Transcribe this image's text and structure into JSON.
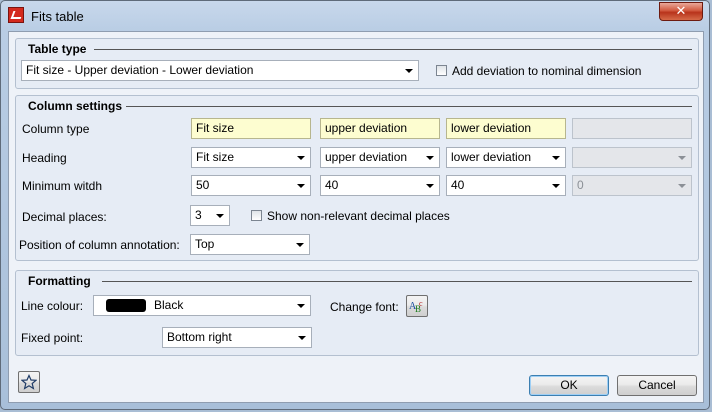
{
  "window": {
    "title": "Fits table",
    "close_label": "✕"
  },
  "table_type": {
    "group_title": "Table type",
    "selected": "Fit size - Upper deviation - Lower deviation",
    "add_deviation_label": "Add deviation to nominal dimension",
    "add_deviation_checked": false
  },
  "column_settings": {
    "group_title": "Column settings",
    "column_type_label": "Column type",
    "heading_label": "Heading",
    "min_width_label": "Minimum witdh",
    "decimal_label": "Decimal places:",
    "position_label": "Position of column annotation:",
    "column_types": [
      "Fit size",
      "upper deviation",
      "lower deviation",
      ""
    ],
    "headings": [
      "Fit size",
      "upper deviation",
      "lower deviation",
      ""
    ],
    "min_widths": [
      "50",
      "40",
      "40",
      "0"
    ],
    "decimal_places": "3",
    "show_nonrelevant_label": "Show non-relevant decimal places",
    "show_nonrelevant_checked": false,
    "position": "Top"
  },
  "formatting": {
    "group_title": "Formatting",
    "line_colour_label": "Line colour:",
    "line_colour_value": "Black",
    "line_colour_hex": "#000000",
    "change_font_label": "Change font:",
    "fixed_point_label": "Fixed point:",
    "fixed_point_value": "Bottom right"
  },
  "footer": {
    "ok_label": "OK",
    "cancel_label": "Cancel"
  }
}
